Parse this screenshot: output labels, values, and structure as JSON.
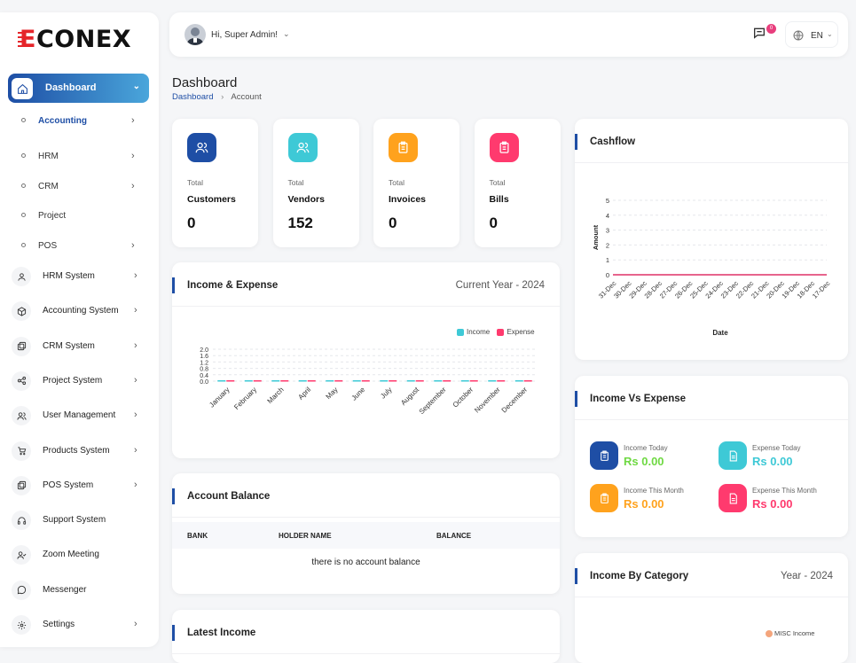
{
  "brand": {
    "prefix": "E",
    "rest": "CONEX",
    "logo_text": "ECONEX"
  },
  "sidebar": {
    "dashboard": "Dashboard",
    "sub_items": [
      {
        "label": "Accounting",
        "has_chevron": true,
        "active": true
      },
      {
        "label": "HRM",
        "has_chevron": true
      },
      {
        "label": "CRM",
        "has_chevron": true
      },
      {
        "label": "Project",
        "has_chevron": false
      },
      {
        "label": "POS",
        "has_chevron": true
      }
    ],
    "items": [
      {
        "label": "HRM System",
        "icon": "user-icon",
        "has_chevron": true
      },
      {
        "label": "Accounting System",
        "icon": "box-icon",
        "has_chevron": true
      },
      {
        "label": "CRM System",
        "icon": "layers-icon",
        "has_chevron": true
      },
      {
        "label": "Project System",
        "icon": "share-icon",
        "has_chevron": true
      },
      {
        "label": "User Management",
        "icon": "users-icon",
        "has_chevron": true
      },
      {
        "label": "Products System",
        "icon": "cart-icon",
        "has_chevron": true
      },
      {
        "label": "POS System",
        "icon": "layers-icon",
        "has_chevron": true
      },
      {
        "label": "Support System",
        "icon": "headset-icon",
        "has_chevron": false
      },
      {
        "label": "Zoom Meeting",
        "icon": "user-check-icon",
        "has_chevron": false
      },
      {
        "label": "Messenger",
        "icon": "chat-icon",
        "has_chevron": false
      },
      {
        "label": "Settings",
        "icon": "gear-icon",
        "has_chevron": true
      }
    ]
  },
  "header": {
    "greeting": "Hi, Super Admin!",
    "notification_count": "0",
    "language": "EN"
  },
  "page": {
    "title": "Dashboard",
    "breadcrumb": [
      "Dashboard",
      "Account"
    ]
  },
  "stats": [
    {
      "label": "Total",
      "name": "Customers",
      "value": "0",
      "color": "#1e4ea5"
    },
    {
      "label": "Total",
      "name": "Vendors",
      "value": "152",
      "color": "#3ec9d6"
    },
    {
      "label": "Total",
      "name": "Invoices",
      "value": "0",
      "color": "#ffa21d"
    },
    {
      "label": "Total",
      "name": "Bills",
      "value": "0",
      "color": "#ff3a6e"
    }
  ],
  "income_expense": {
    "title": "Income & Expense",
    "period": "Current Year - 2024",
    "legend": [
      "Income",
      "Expense"
    ]
  },
  "account_balance": {
    "title": "Account Balance",
    "columns": [
      "BANK",
      "HOLDER NAME",
      "BALANCE"
    ],
    "empty_message": "there is no account balance"
  },
  "latest_income": {
    "title": "Latest Income"
  },
  "cashflow": {
    "title": "Cashflow"
  },
  "income_vs_expense": {
    "title": "Income Vs Expense",
    "items": [
      {
        "label": "Income Today",
        "value": "Rs 0.00",
        "color": "#6fd943",
        "box": "#1e4ea5"
      },
      {
        "label": "Expense Today",
        "value": "Rs 0.00",
        "color": "#3ec9d6",
        "box": "#3ec9d6"
      },
      {
        "label": "Income This Month",
        "value": "Rs 0.00",
        "color": "#ffa21d",
        "box": "#ffa21d"
      },
      {
        "label": "Expense This Month",
        "value": "Rs 0.00",
        "color": "#ff3a6e",
        "box": "#ff3a6e"
      }
    ]
  },
  "income_by_category": {
    "title": "Income By Category",
    "period": "Year - 2024",
    "legend": [
      "MISC Income"
    ]
  },
  "chart_data": [
    {
      "type": "bar",
      "categories": [
        "January",
        "February",
        "March",
        "April",
        "May",
        "June",
        "July",
        "August",
        "September",
        "October",
        "November",
        "December"
      ],
      "series": [
        {
          "name": "Income",
          "values": [
            0,
            0,
            0,
            0,
            0,
            0,
            0,
            0,
            0,
            0,
            0,
            0
          ],
          "color": "#3ec9d6"
        },
        {
          "name": "Expense",
          "values": [
            0,
            0,
            0,
            0,
            0,
            0,
            0,
            0,
            0,
            0,
            0,
            0
          ],
          "color": "#ff3a6e"
        }
      ],
      "yticks": [
        "0.0",
        "0.4",
        "0.8",
        "1.2",
        "1.6",
        "2.0"
      ],
      "ylim": [
        0,
        2
      ],
      "legend": "top-right",
      "grid": true
    },
    {
      "type": "line",
      "x": [
        "31-Dec",
        "30-Dec",
        "29-Dec",
        "28-Dec",
        "27-Dec",
        "26-Dec",
        "25-Dec",
        "24-Dec",
        "23-Dec",
        "22-Dec",
        "21-Dec",
        "20-Dec",
        "19-Dec",
        "18-Dec",
        "17-Dec"
      ],
      "series": [
        {
          "values": [
            0,
            0,
            0,
            0,
            0,
            0,
            0,
            0,
            0,
            0,
            0,
            0,
            0,
            0,
            0
          ],
          "color": "#3ec9d6"
        },
        {
          "values": [
            0,
            0,
            0,
            0,
            0,
            0,
            0,
            0,
            0,
            0,
            0,
            0,
            0,
            0,
            0
          ],
          "color": "#ff3a6e"
        }
      ],
      "yticks": [
        "0",
        "1",
        "2",
        "3",
        "4",
        "5"
      ],
      "ylim": [
        0,
        5
      ],
      "xlabel": "Date",
      "ylabel": "Amount",
      "grid": true
    }
  ]
}
